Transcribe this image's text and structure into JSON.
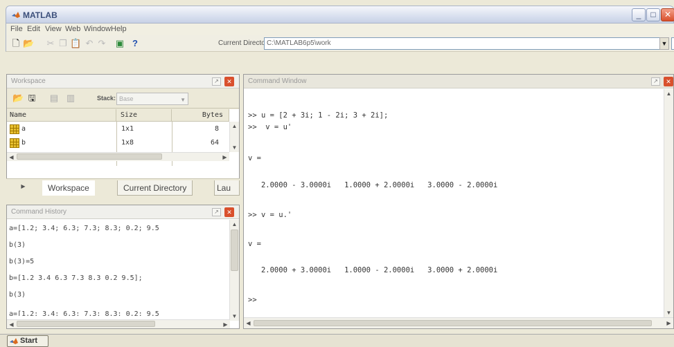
{
  "window": {
    "title": "MATLAB",
    "minimize": "_",
    "maximize": "□",
    "close": "✕"
  },
  "menu": [
    "File",
    "Edit",
    "View",
    "Web",
    "Window",
    "Help"
  ],
  "toolbar": {
    "current_directory_label": "Current Directory:",
    "current_directory_value": "C:\\MATLAB6p5\\work",
    "help_glyph": "?"
  },
  "workspace": {
    "title": "Workspace",
    "stack_label": "Stack:",
    "stack_value": "Base",
    "columns": [
      "Name",
      "Size",
      "Bytes"
    ],
    "rows": [
      {
        "name": "a",
        "size": "1x1",
        "bytes": "8"
      },
      {
        "name": "b",
        "size": "1x8",
        "bytes": "64"
      }
    ]
  },
  "tabs": [
    "Workspace",
    "Current Directory",
    "Lau"
  ],
  "command_history": {
    "title": "Command History",
    "lines": [
      "a=[1.2; 3.4; 6.3; 7.3; 8.3; 0.2; 9.5",
      "b(3)",
      "b(3)=5",
      "b=[1.2 3.4 6.3 7.3 8.3 0.2 9.5];",
      "b(3)",
      "a=[1.2; 3.4; 6.3; 7.3; 8.3; 0.2; 9.5"
    ]
  },
  "command_window": {
    "title": "Command Window",
    "lines": [
      ">> u = [2 + 3i; 1 - 2i; 3 + 2i];",
      ">>  v = u'",
      "v =",
      "   2.0000 - 3.0000i   1.0000 + 2.0000i   3.0000 - 2.0000i",
      ">> v = u.'",
      "v =",
      "   2.0000 + 3.0000i   1.0000 - 2.0000i   3.0000 + 2.0000i",
      ">>"
    ]
  },
  "taskbar": {
    "start_label": "Start"
  },
  "colors": {
    "accent": "#d9502d",
    "titlebar": "#d9e0ef",
    "matrix_icon": "#e8c030"
  }
}
